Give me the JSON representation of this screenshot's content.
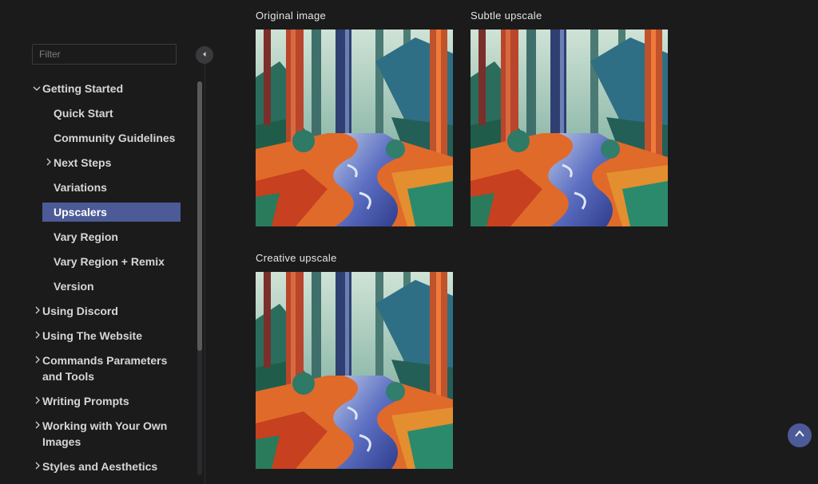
{
  "sidebar": {
    "filter_placeholder": "Filter",
    "items": [
      {
        "label": "Getting Started"
      },
      {
        "label": "Quick Start"
      },
      {
        "label": "Community Guidelines"
      },
      {
        "label": "Next Steps"
      },
      {
        "label": "Variations"
      },
      {
        "label": "Upscalers"
      },
      {
        "label": "Vary Region"
      },
      {
        "label": "Vary Region + Remix"
      },
      {
        "label": "Version"
      },
      {
        "label": "Using Discord"
      },
      {
        "label": "Using The Website"
      },
      {
        "label": "Commands Parameters and Tools"
      },
      {
        "label": "Writing Prompts"
      },
      {
        "label": "Working with Your Own Images"
      },
      {
        "label": "Styles and Aesthetics"
      }
    ],
    "active_item": "Upscalers"
  },
  "main": {
    "images": [
      {
        "caption": "Original image",
        "alt": "Original image"
      },
      {
        "caption": "Subtle upscale",
        "alt": "Subtle upscale"
      },
      {
        "caption": "Creative upscale",
        "alt": "Creative upscale"
      }
    ]
  },
  "colors": {
    "background": "#1b1b1c",
    "accent": "#4c5a97",
    "text": "#d6d6d6"
  },
  "icons": {
    "collapse": "chevron-left-icon",
    "scroll_top": "chevron-up-icon",
    "expand": "chevron-right-icon",
    "expanded": "chevron-down-icon"
  }
}
